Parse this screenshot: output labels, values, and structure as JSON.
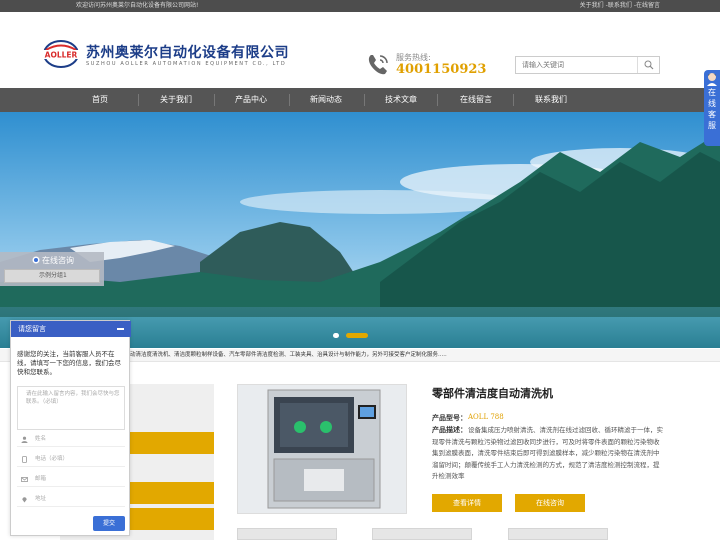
{
  "topbar": {
    "welcome": "欢迎访问苏州奥莱尔自动化设备有限公司网站!",
    "links": [
      "关于我们",
      "-联系我们",
      "-在线留言"
    ]
  },
  "header": {
    "logo_text": "AOLLER",
    "company_cn": "苏州奥莱尔自动化设备有限公司",
    "company_en": "SUZHOU AOLLER AUTOMATION EQUIPMENT CO., LTD",
    "phone_label": "服务热线:",
    "phone_number": "4001150923",
    "search_placeholder": "请输入关键词"
  },
  "nav": {
    "items": [
      "首页",
      "关于我们",
      "产品中心",
      "新闻动态",
      "技术文章",
      "在线留言",
      "联系我们"
    ]
  },
  "banner": {
    "active_dot": 1
  },
  "ticker": {
    "text": "动清洁度清洗机、清洁度颗粒制样设备、汽车零部件清洁度检测、工装夹具、治具设计与制作能力，另外可接受客户定制化服务....."
  },
  "consult": {
    "title": "在线咨询",
    "tab": "示例分组1"
  },
  "message": {
    "header": "请您留言",
    "intro": "感谢您的关注，当前客服人员不在线，请填写一下您的信息，我们会尽快和您联系。",
    "textarea_placeholder": "请在此输入留言内容，我们会尽快与您联系。（必填）",
    "fields": [
      "姓名",
      "电话（必填）",
      "邮箱",
      "地址"
    ],
    "submit": "提交"
  },
  "product": {
    "title": "零部件清洁度自动清洗机",
    "model_label": "产品型号：",
    "model_value": "AOLL 788",
    "desc_label": "产品描述：",
    "desc": "设备集成压力喷射清洗、清洗剂在线过滤回收、循环精滤于一体，实现零件清洗与颗粒污染物过滤回收同步进行，可及时将零件表面的颗粒污染物收集到滤膜表面，清洗零件结束后即可得到滤膜样本，减少颗粒污染物在清洗剂中溜留时间；颠覆传统手工人力清洗检测的方式，规范了清洁度检测控制流程，提升检测效率",
    "btn_detail": "查看详情",
    "btn_consult": "在线咨询"
  },
  "side_service": {
    "text": [
      "在",
      "线",
      "客",
      "服"
    ]
  },
  "colors": {
    "accent": "#e2a800",
    "brand_blue": "#1c3d88",
    "widget_blue": "#3a5fc4",
    "nav_bg": "#555555"
  }
}
